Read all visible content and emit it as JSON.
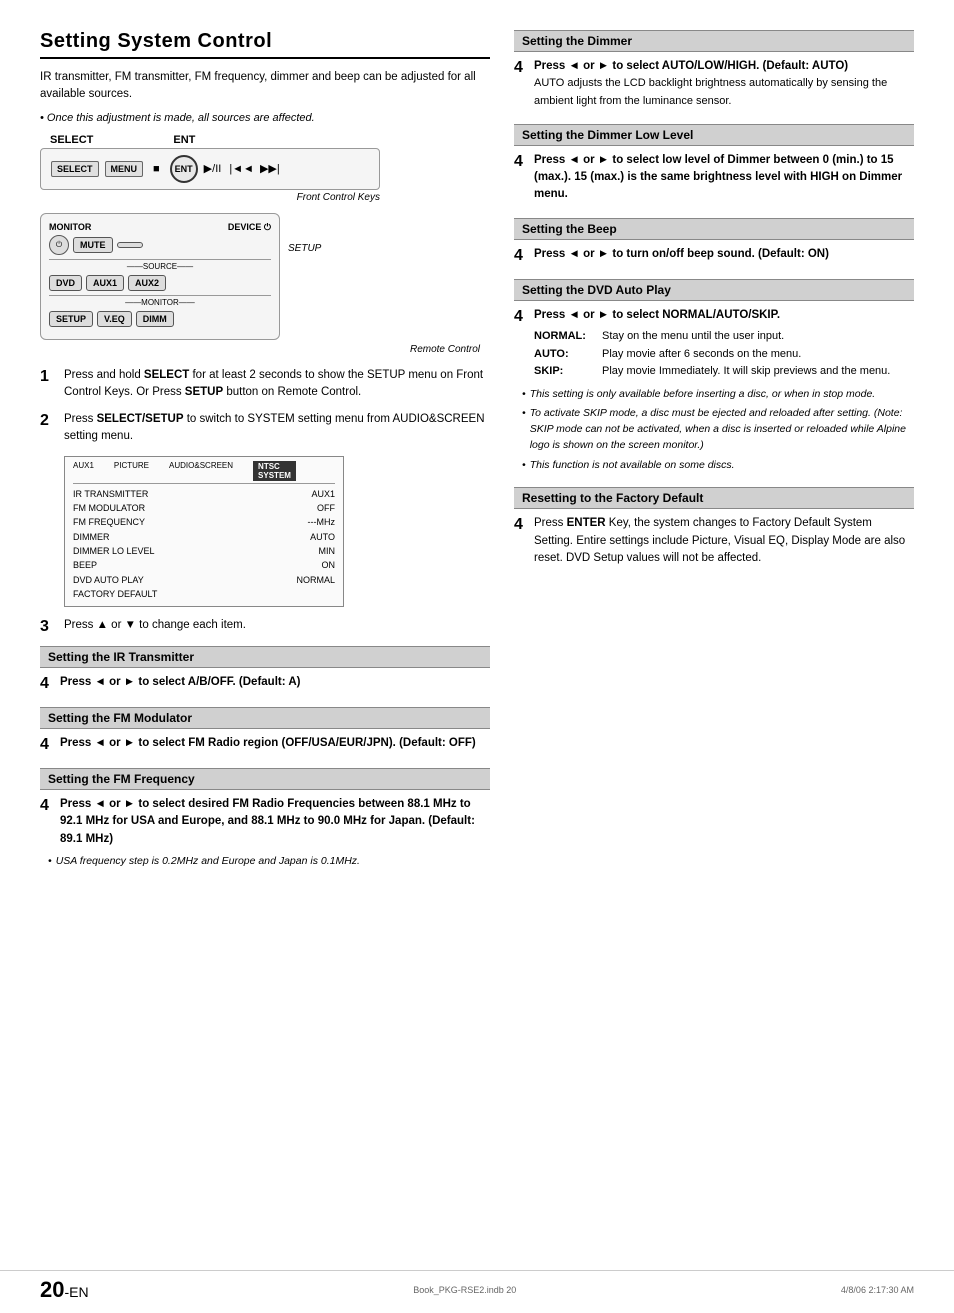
{
  "page": {
    "title": "Setting System Control",
    "intro": "IR transmitter, FM transmitter, FM frequency, dimmer and beep can be adjusted for all available sources.",
    "italic_note": "Once this adjustment is made, all sources are affected.",
    "diagram": {
      "select_label": "SELECT",
      "ent_label": "ENT",
      "front_caption": "Front Control Keys",
      "remote_caption": "Remote Control"
    },
    "steps": [
      {
        "num": "1",
        "text": "Press and hold SELECT for at least 2 seconds to show the SETUP menu on Front Control Keys. Or Press SETUP button on Remote Control."
      },
      {
        "num": "2",
        "text": "Press SELECT/SETUP to switch to SYSTEM setting menu from AUDIO&SCREEN setting menu."
      },
      {
        "num": "3",
        "text": "Press ▲ or ▼ to change each item."
      }
    ],
    "menu": {
      "header_left": "AUX1",
      "header_mid": "AUDIO&SCREEN",
      "header_right": "NTSC",
      "header_right2": "SYSTEM",
      "rows": [
        {
          "label": "IR TRANSMITTER",
          "value": "AUX1"
        },
        {
          "label": "FM MODULATOR",
          "value": "OFF"
        },
        {
          "label": "FM FREQUENCY",
          "value": "---MHz"
        },
        {
          "label": "DIMMER",
          "value": "AUTO"
        },
        {
          "label": "DIMMER LO LEVEL",
          "value": "MIN"
        },
        {
          "label": "BEEP",
          "value": "ON"
        },
        {
          "label": "DVD AUTO PLAY",
          "value": "NORMAL"
        },
        {
          "label": "FACTORY DEFAULT",
          "value": ""
        }
      ]
    },
    "right_sections": [
      {
        "id": "dimmer",
        "header": "Setting the Dimmer",
        "step_num": "4",
        "step_text": "Press ◄ or ► to select AUTO/LOW/HIGH. (Default: AUTO)",
        "detail": "AUTO adjusts the LCD backlight brightness automatically by sensing the ambient light from the luminance sensor.",
        "notes": []
      },
      {
        "id": "dimmer_low",
        "header": "Setting the Dimmer Low Level",
        "step_num": "4",
        "step_text": "Press ◄ or ► to select low level of Dimmer between 0 (min.) to 15 (max.). 15 (max.) is the same brightness level with HIGH on Dimmer menu.",
        "detail": "",
        "notes": []
      },
      {
        "id": "beep",
        "header": "Setting the Beep",
        "step_num": "4",
        "step_text": "Press ◄ or ► to turn on/off beep sound. (Default: ON)",
        "detail": "",
        "notes": []
      },
      {
        "id": "dvd_auto_play",
        "header": "Setting the DVD Auto Play",
        "step_num": "4",
        "step_text": "Press ◄ or ► to select NORMAL/AUTO/SKIP.",
        "sub_rows": [
          {
            "key": "NORMAL:",
            "value": "Stay on the menu until the user input."
          },
          {
            "key": "AUTO:",
            "value": "Play movie after 6 seconds on the menu."
          },
          {
            "key": "SKIP:",
            "value": "Play movie Immediately. It will skip previews and the menu."
          }
        ],
        "notes": [
          "This setting is only available before inserting a disc, or when in stop mode.",
          "To activate SKIP mode, a disc must be ejected and reloaded after setting. (Note: SKIP mode can not be activated, when a disc is inserted or reloaded while Alpine logo is shown on the screen monitor.)",
          "This function is not available on some discs."
        ]
      },
      {
        "id": "factory_default",
        "header": "Resetting to the Factory Default",
        "step_num": "4",
        "step_text": "Press ENTER Key, the system changes to Factory Default System Setting. Entire settings include Picture, Visual EQ, Display Mode are also reset. DVD Setup values will not be affected.",
        "notes": []
      }
    ],
    "left_sections": [
      {
        "id": "ir_transmitter",
        "header": "Setting the IR Transmitter",
        "step_num": "4",
        "step_text": "Press ◄ or ► to select A/B/OFF. (Default: A)"
      },
      {
        "id": "fm_modulator",
        "header": "Setting the FM Modulator",
        "step_num": "4",
        "step_text": "Press ◄ or ► to select FM Radio region (OFF/USA/EUR/JPN). (Default: OFF)"
      },
      {
        "id": "fm_frequency",
        "header": "Setting the  FM Frequency",
        "step_num": "4",
        "step_text": "Press ◄ or ► to select desired FM Radio Frequencies between 88.1 MHz to 92.1 MHz for USA and Europe, and 88.1 MHz to 90.0 MHz for Japan. (Default: 89.1 MHz)",
        "note": "USA frequency step is 0.2MHz and Europe and Japan is 0.1MHz."
      }
    ],
    "footer": {
      "page_num": "20",
      "en_suffix": "-EN",
      "filename": "Book_PKG-RSE2.indb   20",
      "date": "4/8/06   2:17:30 AM"
    }
  }
}
